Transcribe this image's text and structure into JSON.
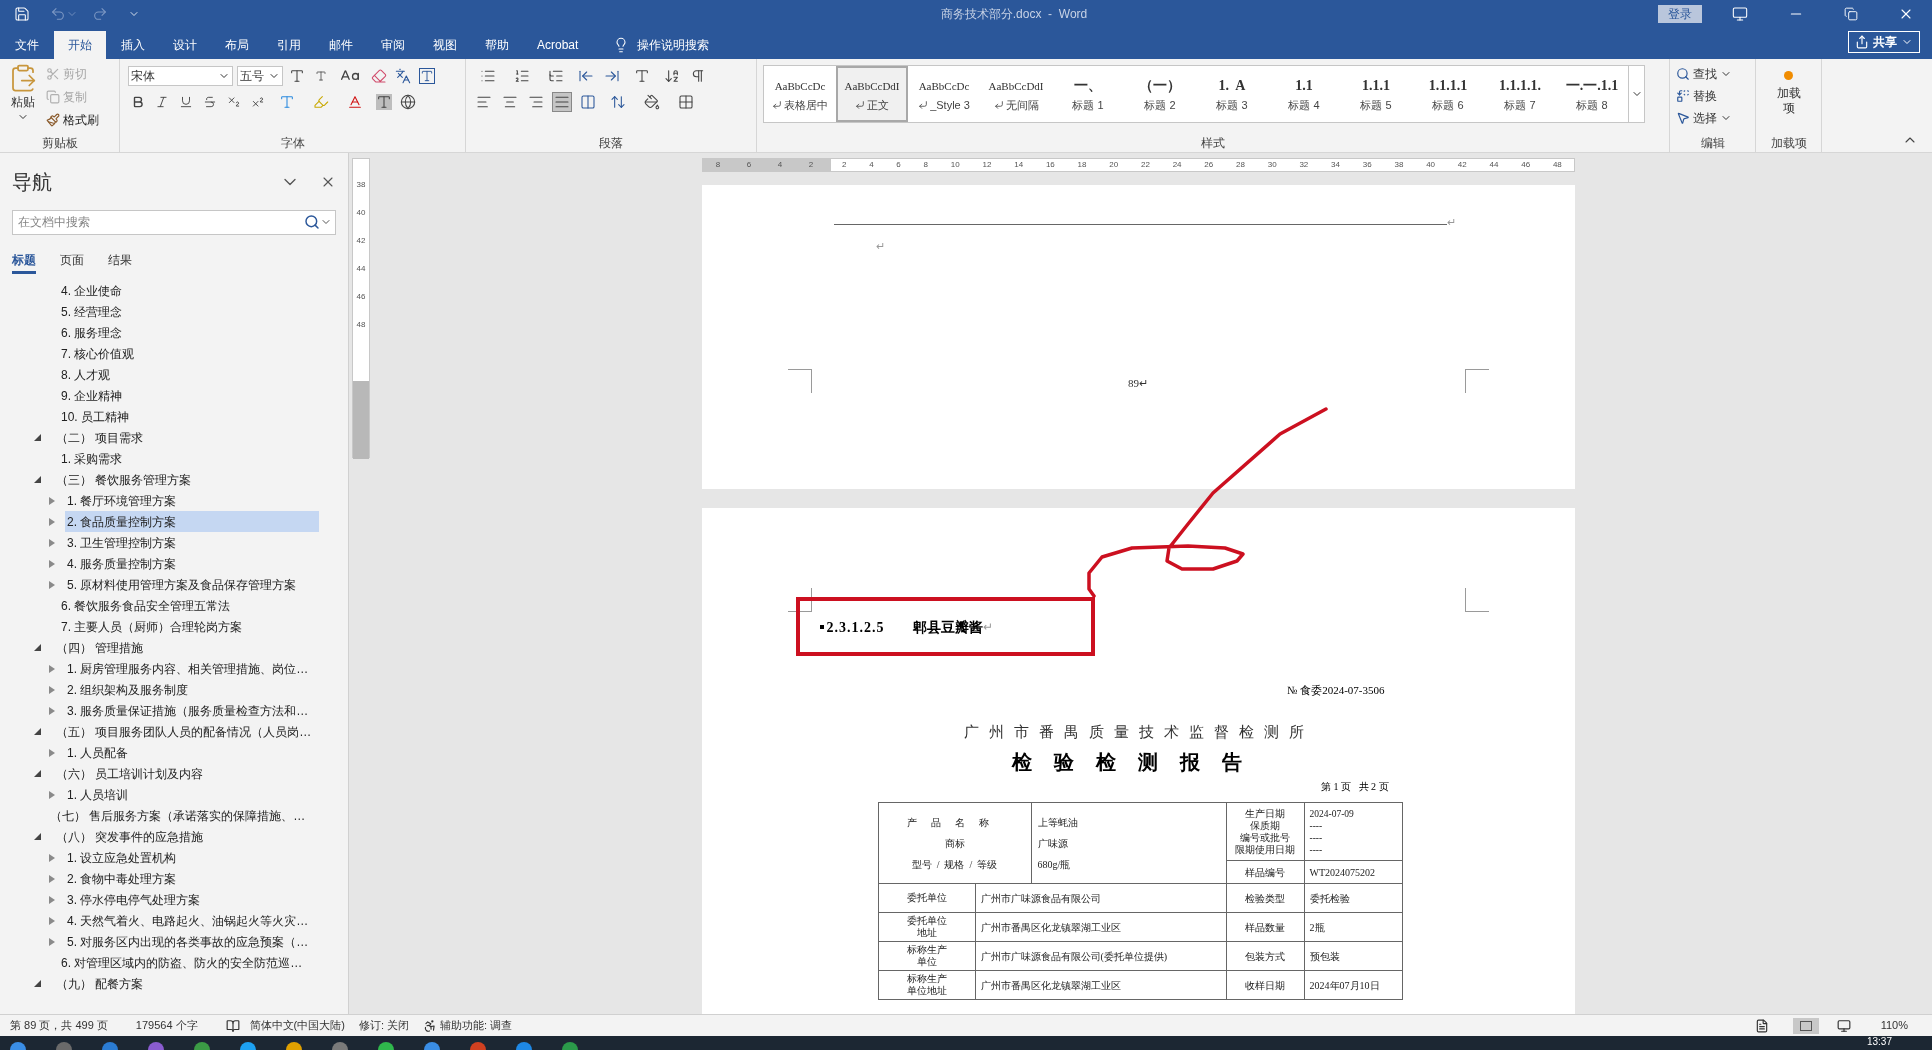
{
  "title_bar": {
    "title": "商务技术部分.docx  -  Word",
    "sign_in": "登录"
  },
  "tabs": [
    {
      "label": "文件",
      "selected": false
    },
    {
      "label": "开始",
      "selected": true
    },
    {
      "label": "插入",
      "selected": false
    },
    {
      "label": "设计",
      "selected": false
    },
    {
      "label": "布局",
      "selected": false
    },
    {
      "label": "引用",
      "selected": false
    },
    {
      "label": "邮件",
      "selected": false
    },
    {
      "label": "审阅",
      "selected": false
    },
    {
      "label": "视图",
      "selected": false
    },
    {
      "label": "帮助",
      "selected": false
    },
    {
      "label": "Acrobat",
      "selected": false
    }
  ],
  "tell_me": "操作说明搜索",
  "share": "共享",
  "ribbon": {
    "clipboard": {
      "paste": "粘贴",
      "actions": [
        {
          "label": "剪切",
          "disabled": true
        },
        {
          "label": "复制",
          "disabled": true
        },
        {
          "label": "格式刷",
          "disabled": false
        }
      ],
      "group": "剪贴板"
    },
    "font": {
      "font_name": "宋体",
      "font_size": "五号",
      "group": "字体"
    },
    "paragraph": {
      "group": "段落"
    },
    "styles": {
      "items": [
        {
          "preview": "AaBbCcDc",
          "name": "表格居中",
          "kind": "paragraph",
          "selected": false
        },
        {
          "preview": "AaBbCcDdI",
          "name": "正文",
          "kind": "paragraph",
          "selected": true
        },
        {
          "preview": "AaBbCcDc",
          "name": "_Style 3",
          "kind": "paragraph",
          "selected": false
        },
        {
          "preview": "AaBbCcDdI",
          "name": "无间隔",
          "kind": "paragraph",
          "selected": false
        },
        {
          "preview": "一、",
          "name": "标题 1",
          "kind": "heading",
          "selected": false
        },
        {
          "preview": "（一）",
          "name": "标题 2",
          "kind": "heading",
          "selected": false
        },
        {
          "preview": "1.  A",
          "name": "标题 3",
          "kind": "heading",
          "selected": false
        },
        {
          "preview": "1.1",
          "name": "标题 4",
          "kind": "heading",
          "selected": false
        },
        {
          "preview": "1.1.1",
          "name": "标题 5",
          "kind": "heading",
          "selected": false
        },
        {
          "preview": "1.1.1.1",
          "name": "标题 6",
          "kind": "heading",
          "selected": false
        },
        {
          "preview": "1.1.1.1.",
          "name": "标题 7",
          "kind": "heading",
          "selected": false
        },
        {
          "preview": "一.一.1.1",
          "name": "标题 8",
          "kind": "heading",
          "selected": false
        }
      ],
      "group": "样式"
    },
    "editing": {
      "actions": [
        {
          "label": "查找",
          "kind": "find"
        },
        {
          "label": "替换",
          "kind": "replace"
        },
        {
          "label": "选择",
          "kind": "select"
        }
      ],
      "group": "编辑"
    },
    "addins": {
      "button": "加载项",
      "group": "加载项"
    }
  },
  "navigation": {
    "title": "导航",
    "search_placeholder": "在文档中搜索",
    "tabs": [
      {
        "label": "标题",
        "selected": true
      },
      {
        "label": "页面",
        "selected": false
      },
      {
        "label": "结果",
        "selected": false
      }
    ],
    "continued": [
      {
        "label": "4. 企业使命",
        "kind": "leaf",
        "selected": false
      },
      {
        "label": "5. 经营理念",
        "kind": "leaf",
        "selected": false
      },
      {
        "label": "6. 服务理念",
        "kind": "leaf",
        "selected": false
      },
      {
        "label": "7. 核心价值观",
        "kind": "leaf",
        "selected": false
      },
      {
        "label": "8. 人才观",
        "kind": "leaf",
        "selected": false
      },
      {
        "label": "9. 企业精神",
        "kind": "leaf",
        "selected": false
      },
      {
        "label": "10. 员工精神",
        "kind": "leaf",
        "selected": false
      }
    ],
    "headings": [
      {
        "label": "（二） 项目需求",
        "kind": "expanded",
        "selected": false,
        "children": [
          {
            "label": "1. 采购需求",
            "kind": "leaf",
            "selected": false
          }
        ]
      },
      {
        "label": "（三） 餐饮服务管理方案",
        "kind": "expanded",
        "selected": false,
        "children": [
          {
            "label": "1. 餐厅环境管理方案",
            "kind": "collapsed",
            "selected": false
          },
          {
            "label": "2. 食品质量控制方案",
            "kind": "collapsed",
            "selected": true
          },
          {
            "label": "3. 卫生管理控制方案",
            "kind": "collapsed",
            "selected": false
          },
          {
            "label": "4. 服务质量控制方案",
            "kind": "collapsed",
            "selected": false
          },
          {
            "label": "5. 原材料使用管理方案及食品保存管理方案",
            "kind": "collapsed",
            "selected": false
          },
          {
            "label": "6. 餐饮服务食品安全管理五常法",
            "kind": "leaf",
            "selected": false
          },
          {
            "label": "7. 主要人员（厨师）合理轮岗方案",
            "kind": "leaf",
            "selected": false
          }
        ]
      },
      {
        "label": "（四） 管理措施",
        "kind": "expanded",
        "selected": false,
        "children": [
          {
            "label": "1. 厨房管理服务内容、相关管理措施、岗位…",
            "kind": "collapsed",
            "selected": false
          },
          {
            "label": "2. 组织架构及服务制度",
            "kind": "collapsed",
            "selected": false
          },
          {
            "label": "3. 服务质量保证措施（服务质量检查方法和…",
            "kind": "collapsed",
            "selected": false
          }
        ]
      },
      {
        "label": "（五） 项目服务团队人员的配备情况（人员岗…",
        "kind": "expanded",
        "selected": false,
        "children": [
          {
            "label": "1. 人员配备",
            "kind": "collapsed",
            "selected": false
          }
        ]
      },
      {
        "label": "（六） 员工培训计划及内容",
        "kind": "expanded",
        "selected": false,
        "children": [
          {
            "label": "1. 人员培训",
            "kind": "collapsed",
            "selected": false
          }
        ]
      },
      {
        "label": "（七） 售后服务方案（承诺落实的保障措施、…",
        "kind": "leaf",
        "selected": false
      },
      {
        "label": "（八） 突发事件的应急措施",
        "kind": "expanded",
        "selected": false,
        "children": [
          {
            "label": "1. 设立应急处置机构",
            "kind": "collapsed",
            "selected": false
          },
          {
            "label": "2. 食物中毒处理方案",
            "kind": "collapsed",
            "selected": false
          },
          {
            "label": "3. 停水停电停气处理方案",
            "kind": "collapsed",
            "selected": false
          },
          {
            "label": "4. 天然气着火、电路起火、油锅起火等火灾…",
            "kind": "collapsed",
            "selected": false
          },
          {
            "label": "5. 对服务区内出现的各类事故的应急预案（…",
            "kind": "collapsed",
            "selected": false
          },
          {
            "label": "6. 对管理区域内的防盗、防火的安全防范巡…",
            "kind": "leaf",
            "selected": false
          }
        ]
      },
      {
        "label": "（九） 配餐方案",
        "kind": "expanded",
        "selected": false
      }
    ]
  },
  "ruler": {
    "left_ticks": [
      "8",
      "6",
      "4",
      "2"
    ],
    "ticks": [
      "2",
      "4",
      "6",
      "8",
      "10",
      "12",
      "14",
      "16",
      "18",
      "20",
      "22",
      "24",
      "26",
      "28",
      "30",
      "32",
      "34",
      "36",
      "38",
      "40",
      "42",
      "44",
      "46",
      "48"
    ],
    "vertical_ticks": [
      "38",
      "40",
      "42",
      "44",
      "46",
      "48"
    ]
  },
  "page_1": {
    "rule_mark": "↵",
    "paragraph_mark": "↵",
    "page_number": "89↵"
  },
  "page_2": {
    "heading_number": "2.3.1.2.5",
    "heading_text": "郫县豆瓣酱",
    "paragraph_mark": "↵",
    "report_no": "№  食委2024-07-3506",
    "institute": "广州市番禺质量技术监督检测所",
    "report_title": "检验检测报告",
    "page_info": "第 1 页   共 2 页",
    "product_block": {
      "labels": [
        "产品名称",
        "商标",
        "型号  /  规格  /  等级"
      ],
      "values": [
        "上等蚝油",
        "广味源",
        "680g/瓶"
      ],
      "date_labels": [
        "生产日期",
        "保质期",
        "编号或批号",
        "限期使用日期"
      ],
      "date_values": [
        "2024-07-09",
        "----",
        "----",
        "----"
      ],
      "sample_label": "样品编号",
      "sample_value": "WT2024075202"
    },
    "rows": [
      {
        "label": "委托单位",
        "value": "广州市广味源食品有限公司",
        "label_2": "检验类型",
        "value_2": "委托检验"
      },
      {
        "label": "委托单位地址",
        "value": "广州市番禺区化龙镇翠湖工业区",
        "label_2": "样品数量",
        "value_2": "2瓶"
      },
      {
        "label": "标称生产单位",
        "value": "广州市广味源食品有限公司(委托单位提供)",
        "label_2": "包装方式",
        "value_2": "预包装"
      },
      {
        "label": "标称生产单位地址",
        "value": "广州市番禺区化龙镇翠湖工业区",
        "label_2": "收样日期",
        "value_2": "2024年07月10日"
      }
    ]
  },
  "status_bar": {
    "page": "第 89 页，共 499 页",
    "words": "179564 个字",
    "language": "简体中文(中国大陆)",
    "track_changes": "修订: 关闭",
    "accessibility": "辅助功能: 调查",
    "zoom": "110%"
  },
  "taskbar": {
    "clock": "13:37"
  }
}
